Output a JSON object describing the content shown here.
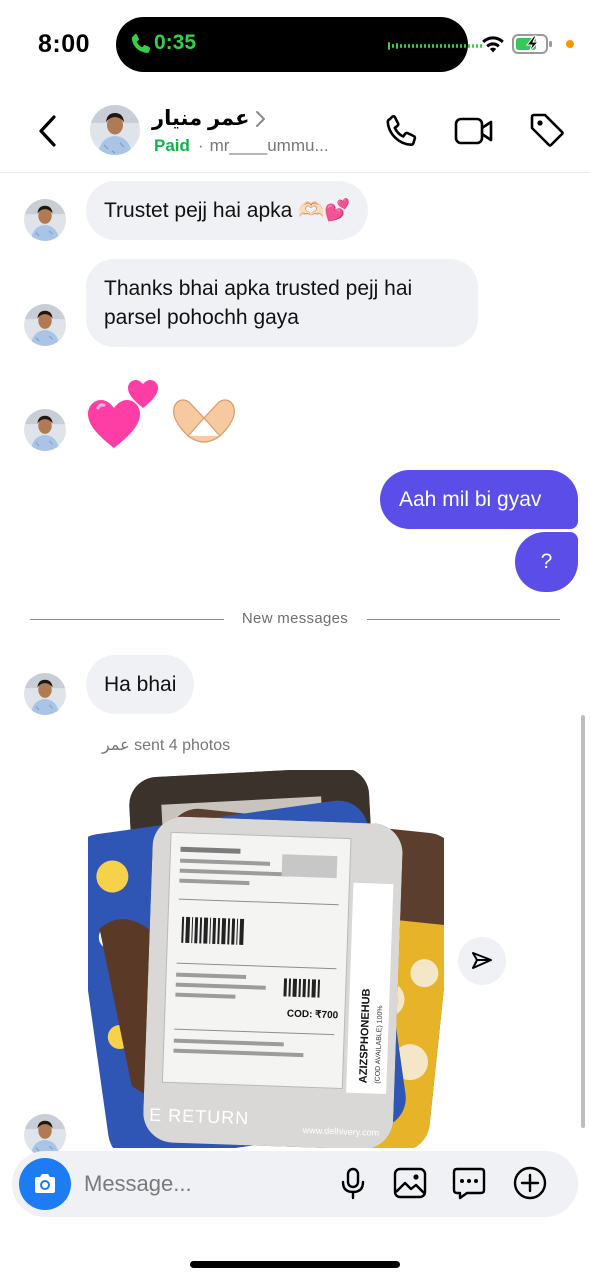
{
  "status_bar": {
    "time": "8:00",
    "call_timer": "0:35",
    "accent_green": "#35d04a",
    "mic_indicator_color": "#ff9500"
  },
  "header": {
    "contact_name": "عمر منيار",
    "paid_label": "Paid",
    "separator": "·",
    "handle": "mr____ummu...",
    "icons": [
      "back-icon",
      "avatar",
      "chevron-right-icon",
      "call-icon",
      "video-icon",
      "tag-icon"
    ]
  },
  "messages": {
    "m1": "Trustet pejj hai apka 🫶🏻💕",
    "m2_line1": "Thanks bhai apka trusted pejj hai",
    "m2_line2": "parsel pohochh gaya",
    "m3_emoji": "💕 🫶🏻",
    "sent_1": "Aah mil bi gyav",
    "sent_2": "?",
    "divider": "New messages",
    "m4": "Ha bhai",
    "photos_caption": "عمر sent 4 photos"
  },
  "package_label": {
    "barcode_label": "COD: ₹700",
    "side_text": "AZIZSPHONEHUB",
    "side_text_2": "(COD AVAILABLE) 100%",
    "phone": "7020514243 / 8175777991",
    "bottom_text": "E RETURN",
    "url_text": "www.delhivery.com"
  },
  "composer": {
    "placeholder": "Message...",
    "icons": [
      "camera-icon",
      "microphone-icon",
      "gallery-icon",
      "sticker-icon",
      "add-icon"
    ]
  },
  "colors": {
    "outgoing_bubble": "#5a4de8",
    "incoming_bubble": "#f0f1f4",
    "camera_button": "#1d7cf2",
    "paid_green": "#12b34c"
  }
}
